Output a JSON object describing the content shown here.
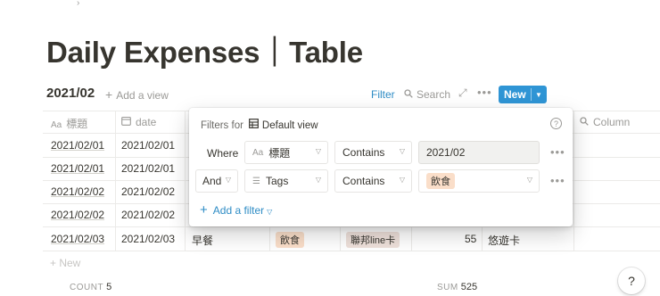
{
  "page": {
    "title": "Daily Expenses｜Table"
  },
  "view": {
    "name": "2021/02",
    "add_view": "Add a view"
  },
  "toolbar": {
    "filter": "Filter",
    "search": "Search",
    "new": "New"
  },
  "table": {
    "columns": [
      {
        "label": "標題",
        "icon": "text-icon"
      },
      {
        "label": "date",
        "icon": "calendar-icon"
      },
      {
        "label": "Column",
        "icon": "search-icon"
      }
    ],
    "rows": [
      {
        "title": "2021/02/01",
        "date": "2021/02/01"
      },
      {
        "title": "2021/02/01",
        "date": "2021/02/01"
      },
      {
        "title": "2021/02/02",
        "date": "2021/02/02"
      },
      {
        "title": "2021/02/02",
        "date": "2021/02/02"
      },
      {
        "title": "2021/02/03",
        "date": "2021/02/03",
        "item": "早餐",
        "category": "飲食",
        "card": "聯邦line卡",
        "amount": "55",
        "payment": "悠遊卡"
      }
    ],
    "new_row": "New",
    "count_label": "COUNT",
    "count_value": "5",
    "sum_label": "SUM",
    "sum_value": "525"
  },
  "filter_popup": {
    "header": "Filters for",
    "view_name": "Default view",
    "rules": [
      {
        "conj": "Where",
        "property": "標題",
        "operator": "Contains",
        "value": "2021/02"
      },
      {
        "conj": "And",
        "property": "Tags",
        "operator": "Contains",
        "value": "飲食"
      }
    ],
    "add_filter": "Add a filter"
  },
  "help": "?",
  "colors": {
    "accent": "#2f95d5",
    "tag_orange": "#fadec9",
    "tag_brown": "#eee0da"
  }
}
